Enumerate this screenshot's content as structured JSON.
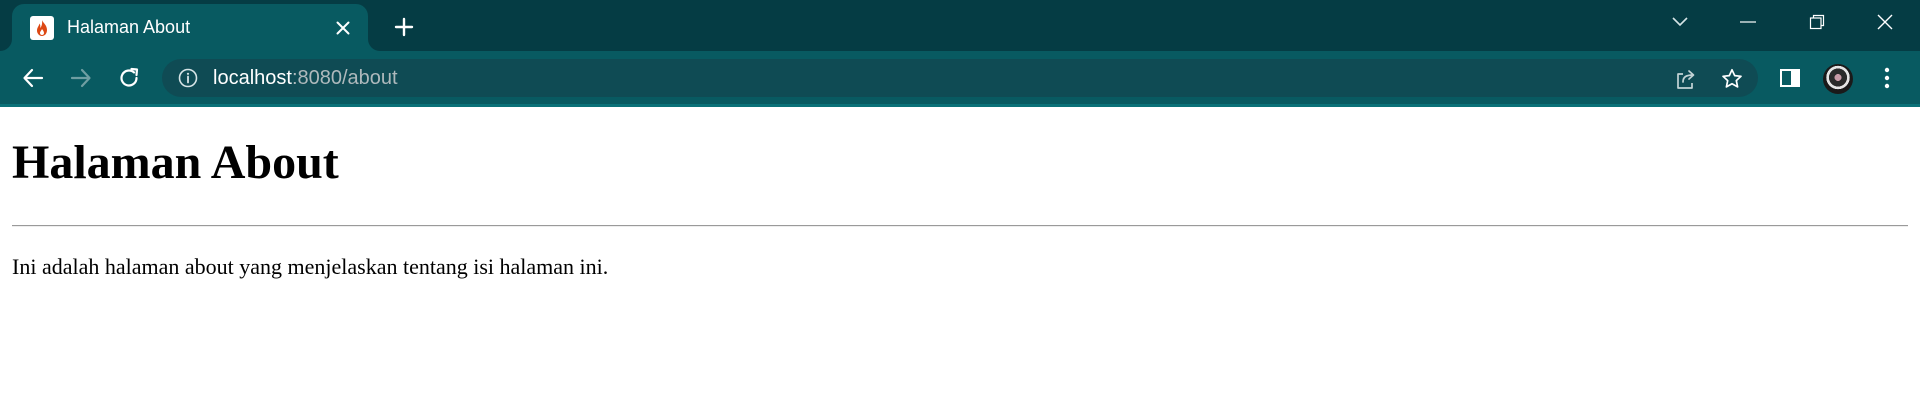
{
  "browser": {
    "tab": {
      "title": "Halaman About",
      "favicon": "codeigniter-flame-icon"
    },
    "address_bar": {
      "host": "localhost",
      "rest": ":8080/about"
    },
    "icons": {
      "back": "arrow-left-icon",
      "forward": "arrow-right-icon",
      "reload": "reload-icon",
      "info": "info-icon",
      "share": "share-icon",
      "bookmark": "star-icon",
      "side_panel": "side-panel-icon",
      "menu": "kebab-menu-icon",
      "tab_search": "chevron-down-icon",
      "minimize": "minimize-icon",
      "restore": "restore-icon",
      "close": "close-icon",
      "new_tab": "plus-icon"
    },
    "colors": {
      "frame": "#053c44",
      "toolbar": "#085a61",
      "omnibox": "#0f4b54"
    }
  },
  "page": {
    "heading": "Halaman About",
    "paragraph": "Ini adalah halaman about yang menjelaskan tentang isi halaman ini."
  }
}
